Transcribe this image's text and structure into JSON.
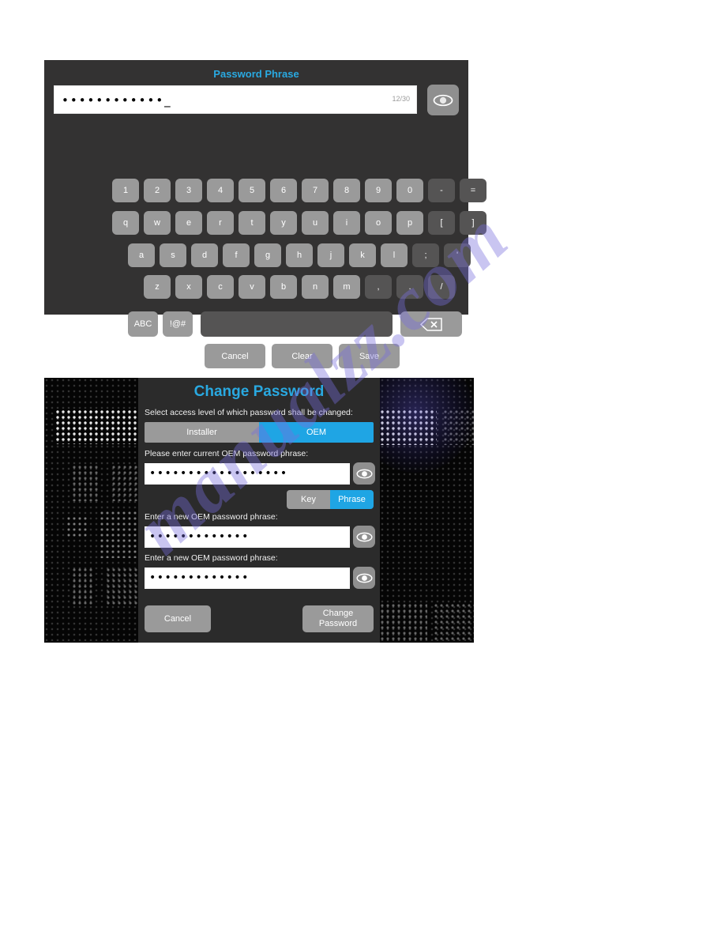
{
  "keyboard_panel": {
    "title": "Password Phrase",
    "input": {
      "value": "••••••••••••_",
      "counter": "12/30"
    },
    "reveal_icon": "eye-icon",
    "rows": [
      [
        {
          "label": "1",
          "dark": false
        },
        {
          "label": "2",
          "dark": false
        },
        {
          "label": "3",
          "dark": false
        },
        {
          "label": "4",
          "dark": false
        },
        {
          "label": "5",
          "dark": false
        },
        {
          "label": "6",
          "dark": false
        },
        {
          "label": "7",
          "dark": false
        },
        {
          "label": "8",
          "dark": false
        },
        {
          "label": "9",
          "dark": false
        },
        {
          "label": "0",
          "dark": false
        },
        {
          "label": "-",
          "dark": true
        },
        {
          "label": "=",
          "dark": true
        }
      ],
      [
        {
          "label": "q",
          "dark": false
        },
        {
          "label": "w",
          "dark": false
        },
        {
          "label": "e",
          "dark": false
        },
        {
          "label": "r",
          "dark": false
        },
        {
          "label": "t",
          "dark": false
        },
        {
          "label": "y",
          "dark": false
        },
        {
          "label": "u",
          "dark": false
        },
        {
          "label": "i",
          "dark": false
        },
        {
          "label": "o",
          "dark": false
        },
        {
          "label": "p",
          "dark": false
        },
        {
          "label": "[",
          "dark": true
        },
        {
          "label": "]",
          "dark": true
        }
      ],
      [
        {
          "label": "a",
          "dark": false
        },
        {
          "label": "s",
          "dark": false
        },
        {
          "label": "d",
          "dark": false
        },
        {
          "label": "f",
          "dark": false
        },
        {
          "label": "g",
          "dark": false
        },
        {
          "label": "h",
          "dark": false
        },
        {
          "label": "j",
          "dark": false
        },
        {
          "label": "k",
          "dark": false
        },
        {
          "label": "l",
          "dark": false
        },
        {
          "label": ";",
          "dark": true
        },
        {
          "label": "'",
          "dark": true
        }
      ],
      [
        {
          "label": "z",
          "dark": false
        },
        {
          "label": "x",
          "dark": false
        },
        {
          "label": "c",
          "dark": false
        },
        {
          "label": "v",
          "dark": false
        },
        {
          "label": "b",
          "dark": false
        },
        {
          "label": "n",
          "dark": false
        },
        {
          "label": "m",
          "dark": false
        },
        {
          "label": ",",
          "dark": true
        },
        {
          "label": ".",
          "dark": true
        },
        {
          "label": "/",
          "dark": true
        }
      ]
    ],
    "function_row": {
      "abc": "ABC",
      "symbols": "!@#",
      "space": "",
      "backspace_icon": "backspace-icon"
    },
    "actions": {
      "cancel": "Cancel",
      "clear": "Clear",
      "save": "Save"
    }
  },
  "change_password_panel": {
    "title": "Change Password",
    "access_label": "Select access level of which password shall be changed:",
    "access_options": [
      "Installer",
      "OEM"
    ],
    "access_selected": "OEM",
    "current_label": "Please enter current OEM password phrase:",
    "current_value": "••••••••••••••••••",
    "mode_options": [
      "Key",
      "Phrase"
    ],
    "mode_selected": "Phrase",
    "new1_label": "Enter a new OEM password phrase:",
    "new1_value": "•••••••••••••",
    "new2_label": "Enter a new OEM password phrase:",
    "new2_value": "•••••••••••••",
    "buttons": {
      "cancel": "Cancel",
      "change": "Change\nPassword"
    },
    "reveal_icon": "eye-icon"
  },
  "watermark": {
    "text": "manualzz.com"
  },
  "colors": {
    "accent_blue": "#29a9e1",
    "segment_on": "#1fa5e4",
    "key_gray": "#9a9a9a",
    "key_dark": "#555454",
    "panel_bg": "#333232",
    "dialog_bg": "#2b2b2b"
  }
}
